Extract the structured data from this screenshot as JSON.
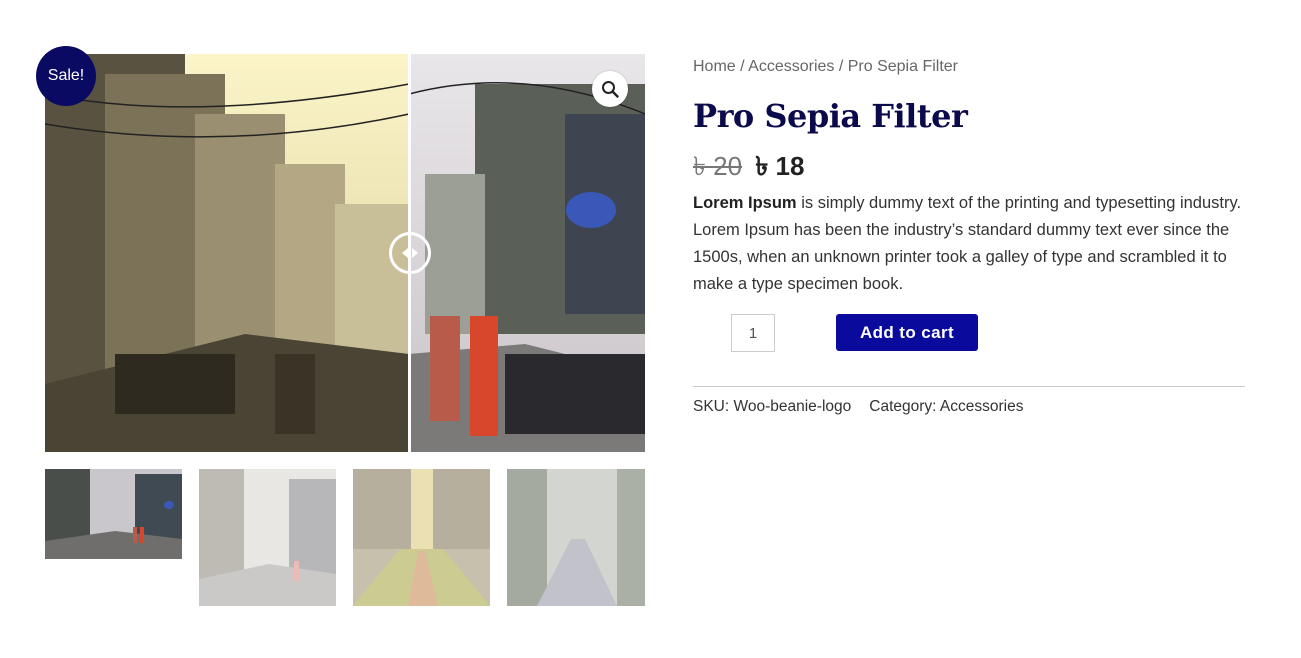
{
  "gallery": {
    "sale_badge": "Sale!",
    "zoom_icon": "search-icon",
    "slider_icon": "compare-slider-handle-icon"
  },
  "breadcrumb": {
    "home": "Home",
    "sep1": " / ",
    "category": "Accessories",
    "sep2": " / ",
    "current": "Pro Sepia Filter"
  },
  "product": {
    "title": "Pro Sepia Filter",
    "price_old": "৳ 20",
    "price_new": "৳ 18",
    "description_bold": "Lorem Ipsum",
    "description_rest": " is simply dummy text of the printing and typesetting industry. Lorem Ipsum has been the industry’s standard dummy text ever since the 1500s, when an unknown printer took a galley of type and scrambled it to make a type specimen book.",
    "quantity": "1",
    "add_to_cart_label": "Add to cart",
    "sku_label": "SKU: ",
    "sku_value": "Woo-beanie-logo",
    "category_label": "Category: ",
    "category_value": "Accessories"
  },
  "colors": {
    "badge": "#0b0a63",
    "button": "#0a0a9c",
    "title": "#0b0a4a"
  }
}
